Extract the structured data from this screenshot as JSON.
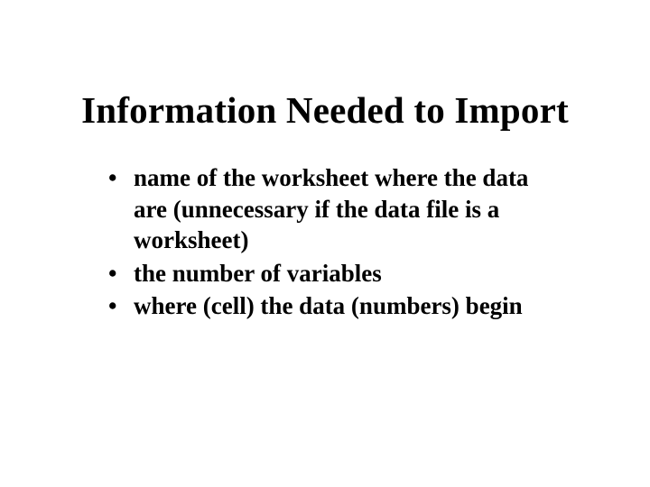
{
  "slide": {
    "title": "Information Needed to Import",
    "bullets": [
      "name of the worksheet where the data are  (unnecessary if the data file is a worksheet)",
      "the number of variables",
      "where (cell) the data (numbers) begin"
    ]
  }
}
